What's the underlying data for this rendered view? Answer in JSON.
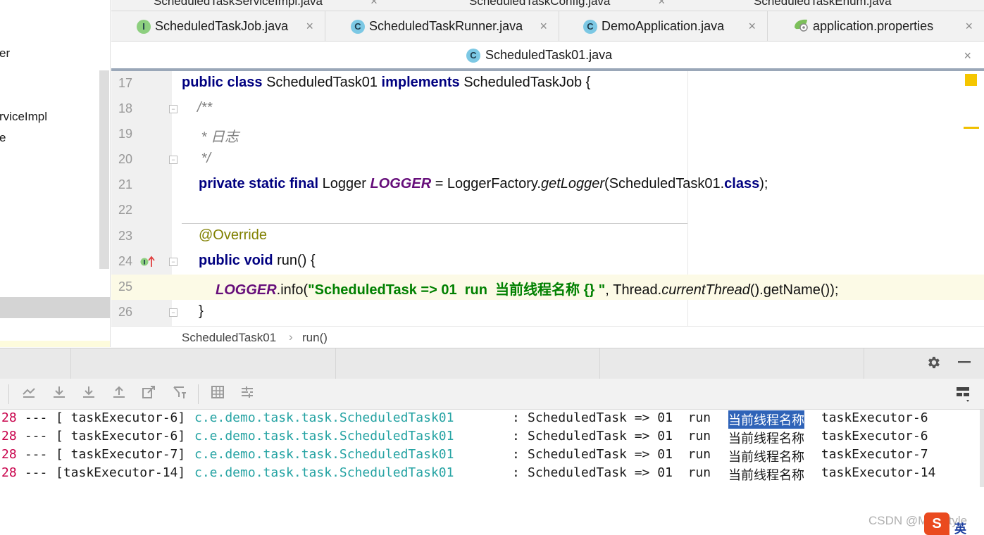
{
  "project_tree": {
    "items": [
      {
        "label": "er"
      },
      {
        "label": "rviceImpl"
      },
      {
        "label": "e"
      }
    ]
  },
  "tabs_top_partial": [
    {
      "label": "ScheduledTaskServiceImpl.java"
    },
    {
      "label": "ScheduledTaskConfig.java"
    },
    {
      "label": "ScheduledTaskEnum.java"
    }
  ],
  "tabs": [
    {
      "label": "ScheduledTaskJob.java",
      "icon": "I",
      "icon_type": "interface"
    },
    {
      "label": "ScheduledTaskRunner.java",
      "icon": "C",
      "icon_type": "class"
    },
    {
      "label": "DemoApplication.java",
      "icon": "C",
      "icon_type": "spring-boot-class"
    },
    {
      "label": "application.properties",
      "icon": "",
      "icon_type": "spring-properties"
    }
  ],
  "active_tab": {
    "label": "ScheduledTask01.java",
    "icon": "C"
  },
  "close_glyph": "×",
  "editor": {
    "lines": [
      {
        "num": "17",
        "t1": "public class ",
        "t2": "ScheduledTask01 ",
        "t3": "implements ",
        "t4": "ScheduledTaskJob {"
      },
      {
        "num": "18",
        "text": "/**"
      },
      {
        "num": "19",
        "text": " * 日志"
      },
      {
        "num": "20",
        "text": " */"
      },
      {
        "num": "21",
        "t1": "private static final ",
        "t2": "Logger ",
        "t3": "LOGGER",
        "t4": " = LoggerFactory.",
        "t5": "getLogger",
        "t6": "(ScheduledTask01.",
        "t7": "class",
        "t8": ");"
      },
      {
        "num": "22",
        "text": ""
      },
      {
        "num": "23",
        "text": "@Override"
      },
      {
        "num": "24",
        "t1": "public void ",
        "t2": "run() {"
      },
      {
        "num": "25",
        "t1": "LOGGER",
        "t2": ".info(",
        "t3": "\"ScheduledTask => 01  run  当前线程名称 {} \"",
        "t4": ", Thread.",
        "t5": "currentThread",
        "t6": "().getName());"
      },
      {
        "num": "26",
        "text": "}"
      }
    ]
  },
  "breadcrumb": {
    "class_name": "ScheduledTask01",
    "separator": "›",
    "method": "run()"
  },
  "console": {
    "lines": [
      {
        "num": "28",
        "sep": " --- ",
        "thread": "[ taskExecutor-6]",
        "logger": "c.e.demo.task.task.ScheduledTask01",
        "colon": ":",
        "msg_a": "ScheduledTask => 01  run  ",
        "msg_b": "当前线程名称",
        "msg_c": " taskExecutor-6",
        "selected": true
      },
      {
        "num": "28",
        "sep": " --- ",
        "thread": "[ taskExecutor-6]",
        "logger": "c.e.demo.task.task.ScheduledTask01",
        "colon": ":",
        "msg_a": "ScheduledTask => 01  run  ",
        "msg_b": "当前线程名称",
        "msg_c": " taskExecutor-6",
        "selected": false
      },
      {
        "num": "28",
        "sep": " --- ",
        "thread": "[ taskExecutor-7]",
        "logger": "c.e.demo.task.task.ScheduledTask01",
        "colon": ":",
        "msg_a": "ScheduledTask => 01  run  ",
        "msg_b": "当前线程名称",
        "msg_c": " taskExecutor-7",
        "selected": false
      },
      {
        "num": "28",
        "sep": " --- ",
        "thread": "[taskExecutor-14]",
        "logger": "c.e.demo.task.task.ScheduledTask01",
        "colon": ":",
        "msg_a": "ScheduledTask => 01  run  ",
        "msg_b": "当前线程名称",
        "msg_c": " taskExecutor-14",
        "selected": false
      }
    ]
  },
  "toolbar_icons": [
    "scroll-to-end-icon",
    "download-icon",
    "download-all-icon",
    "upload-icon",
    "export-icon",
    "filter-icon",
    "table-icon",
    "format-icon"
  ],
  "watermark": "CSDN @My_Style",
  "ime": {
    "badge": "S",
    "text": "英"
  },
  "colors": {
    "keyword": "#000080",
    "string": "#008000",
    "field": "#660e7a",
    "annotation": "#808000",
    "console_num": "#c8004a",
    "console_logger": "#25a3a3",
    "selection": "#2f63b8",
    "current_line": "#fcfae6"
  }
}
